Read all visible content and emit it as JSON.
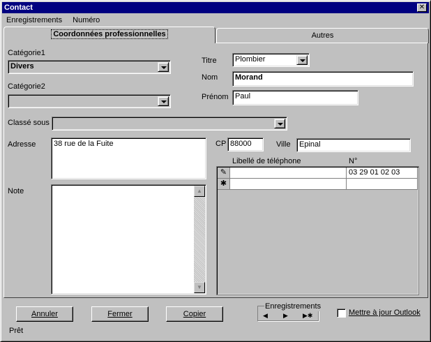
{
  "window": {
    "title": "Contact",
    "close_glyph": "✕"
  },
  "menu": {
    "items": [
      "Enregistrements",
      "Numéro"
    ]
  },
  "tabs": [
    {
      "label": "Coordonnées professionnelles",
      "active": true
    },
    {
      "label": "Autres",
      "active": false
    }
  ],
  "form": {
    "categorie1": {
      "label": "Catégorie1",
      "value": "Divers"
    },
    "categorie2": {
      "label": "Catégorie2",
      "value": ""
    },
    "classe_sous": {
      "label": "Classé sous",
      "value": ""
    },
    "titre": {
      "label": "Titre",
      "value": "Plombier"
    },
    "nom": {
      "label": "Nom",
      "value": "Morand"
    },
    "prenom": {
      "label": "Prénom",
      "value": "Paul"
    },
    "adresse": {
      "label": "Adresse",
      "value": "38 rue de la Fuite"
    },
    "cp": {
      "label": "CP",
      "value": "88000"
    },
    "ville": {
      "label": "Ville",
      "value": "Epinal"
    },
    "note": {
      "label": "Note",
      "value": ""
    }
  },
  "phones": {
    "columns": [
      "Libellé de téléphone",
      "N°"
    ],
    "rows": [
      {
        "marker": "✎",
        "label": "",
        "number": "03 29 01 02 03"
      },
      {
        "marker": "✱",
        "label": "",
        "number": ""
      }
    ]
  },
  "buttons": {
    "annuler": "Annuler",
    "fermer": "Fermer",
    "copier": "Copier"
  },
  "nav": {
    "group_label": "Enregistrements",
    "prev": "◀",
    "next": "▶",
    "new": "▶✱"
  },
  "checkbox": {
    "label": "Mettre à jour Outlook",
    "checked": false
  },
  "status": {
    "text": "Prêt"
  }
}
